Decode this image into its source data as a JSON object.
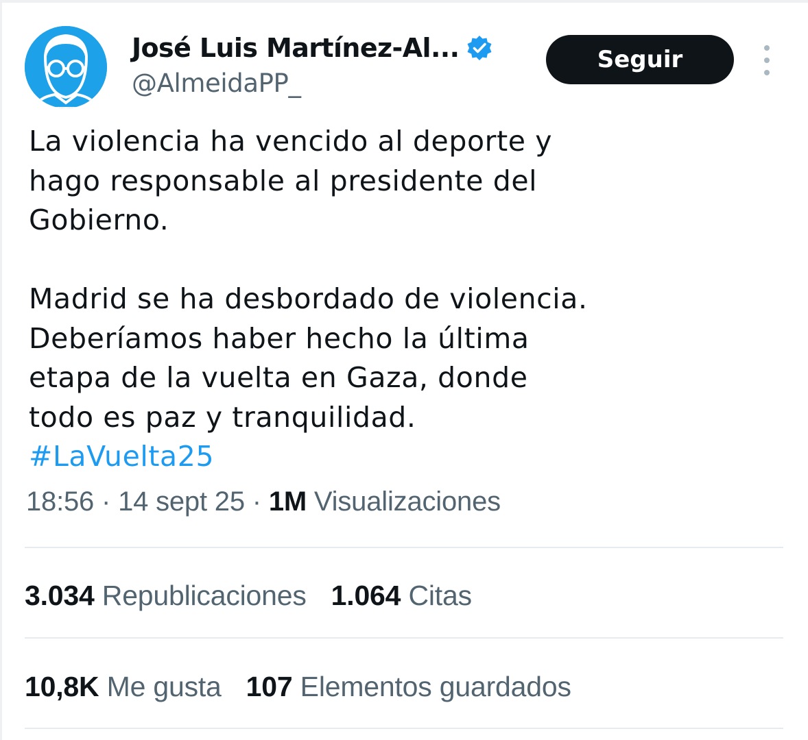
{
  "author": {
    "display_name": "José Luis Martínez-Al...",
    "handle": "@AlmeidaPP_",
    "verified": true,
    "avatar_icon": "cartoon-face-avatar",
    "avatar_color": "#1da1e8"
  },
  "actions": {
    "follow_label": "Seguir",
    "more_icon": "vertical-ellipsis-icon"
  },
  "tweet": {
    "lines": [
      "La violencia ha vencido al deporte y",
      "hago responsable al presidente del",
      "Gobierno.",
      "",
      "Madrid se ha desbordado de violencia.",
      "Deberíamos haber hecho la última",
      "etapa de la vuelta en Gaza, donde",
      "todo es paz y tranquilidad."
    ],
    "hashtag": "#LaVuelta25"
  },
  "meta": {
    "time": "18:56",
    "separator1": " · ",
    "date": "14 sept 25",
    "separator2": " · ",
    "views_count": "1M",
    "views_label": " Visualizaciones"
  },
  "stats": {
    "reposts_count": "3.034",
    "reposts_label": " Republicaciones",
    "quotes_count": "1.064",
    "quotes_label": " Citas",
    "likes_count": "10,8K",
    "likes_label": " Me gusta",
    "bookmarks_count": "107",
    "bookmarks_label": " Elementos guardados"
  },
  "colors": {
    "accent": "#1d9bf0",
    "text": "#0f1419",
    "secondary": "#536471",
    "button": "#0f1419"
  }
}
